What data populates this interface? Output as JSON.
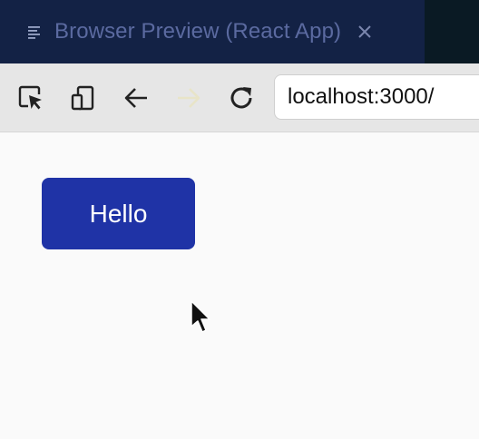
{
  "tab": {
    "title": "Browser Preview (React App)",
    "icon": "menu-lines-icon",
    "close_icon": "close-icon"
  },
  "toolbar": {
    "inspect_icon": "inspect-pointer-icon",
    "device_icon": "device-toggle-icon",
    "back_icon": "back-arrow-icon",
    "forward_icon": "forward-arrow-icon",
    "reload_icon": "reload-icon",
    "url": "localhost:3000/"
  },
  "page": {
    "button_label": "Hello"
  },
  "colors": {
    "tab_background": "#132245",
    "tab_title": "#5b6aa0",
    "button_background": "#1f33a6",
    "button_text": "#ffffff",
    "page_background": "#fafafa"
  }
}
